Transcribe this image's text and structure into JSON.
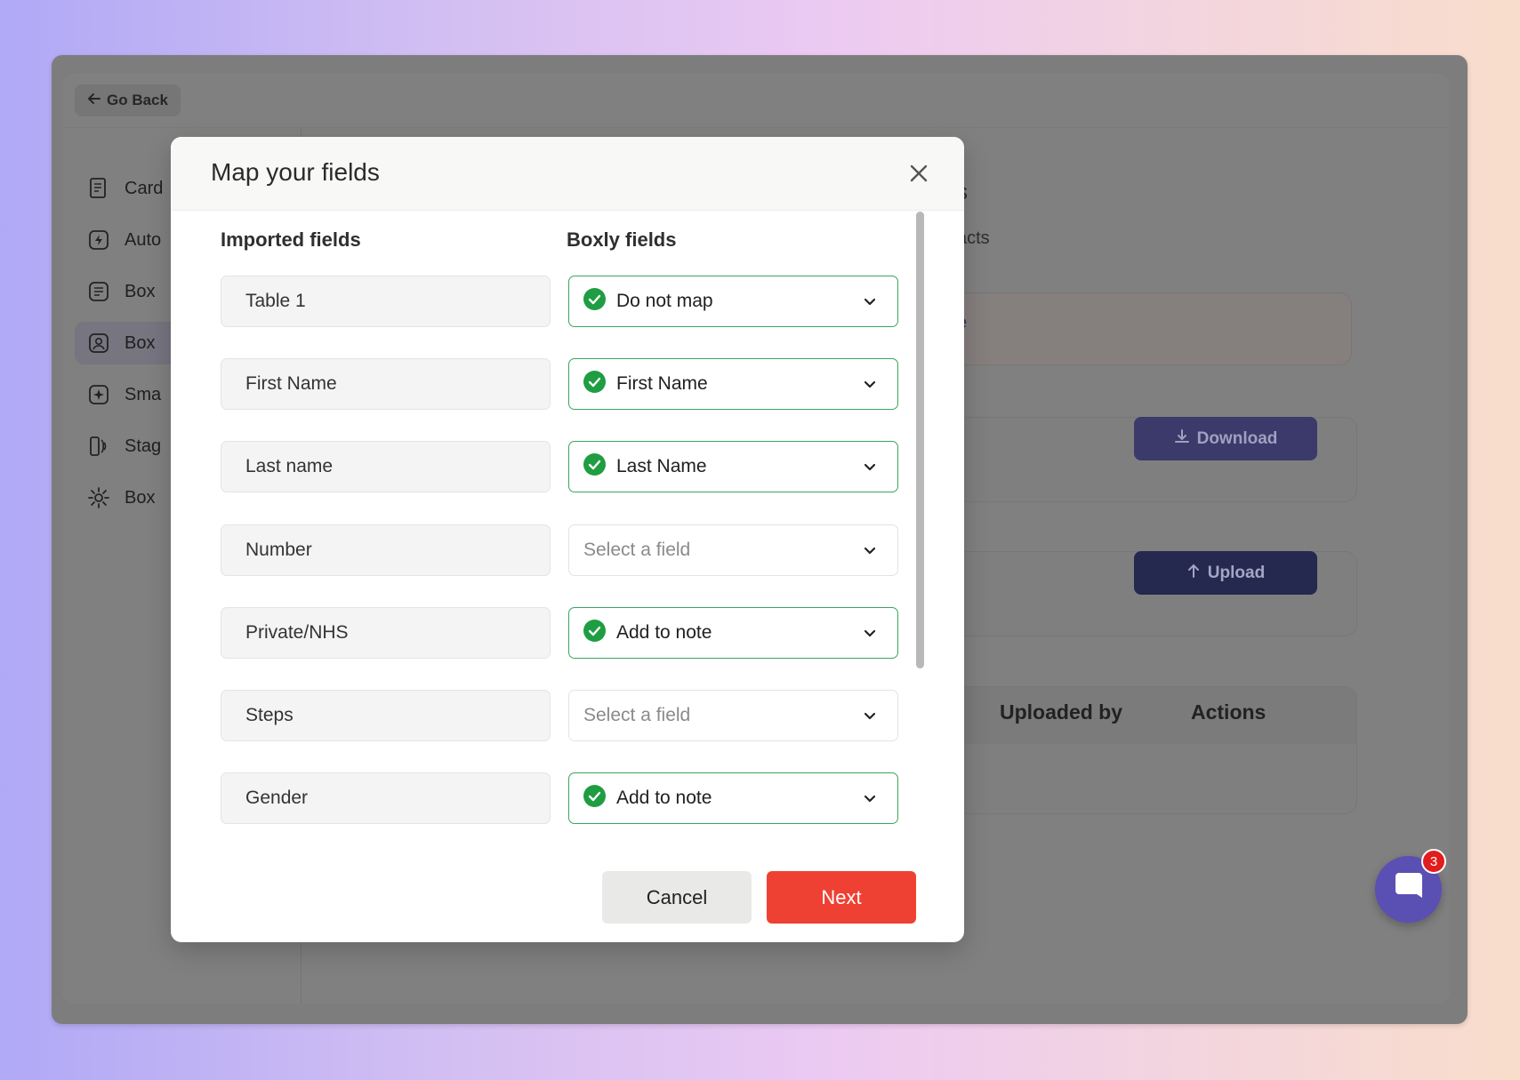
{
  "nav": {
    "back_label": "Go Back"
  },
  "sidebar": {
    "items": [
      {
        "label": "Card"
      },
      {
        "label": "Auto"
      },
      {
        "label": "Box"
      },
      {
        "label": "Box"
      },
      {
        "label": "Sma"
      },
      {
        "label": "Stag"
      },
      {
        "label": "Box"
      }
    ]
  },
  "background": {
    "heading_fragment": "s",
    "subtitle_fragment": "acts",
    "banner_fragment": "e",
    "download_label": "Download",
    "upload_label": "Upload",
    "table_headers": [
      "Uploaded by",
      "Actions"
    ]
  },
  "modal": {
    "title": "Map your fields",
    "col_imported": "Imported fields",
    "col_boxly": "Boxly fields",
    "rows": [
      {
        "imported": "Table 1",
        "mapped": "Do not map"
      },
      {
        "imported": "First Name",
        "mapped": "First Name"
      },
      {
        "imported": "Last name",
        "mapped": "Last Name"
      },
      {
        "imported": "Number",
        "mapped": "Select a field"
      },
      {
        "imported": "Private/NHS",
        "mapped": "Add to note"
      },
      {
        "imported": "Steps",
        "mapped": "Select a field"
      },
      {
        "imported": "Gender",
        "mapped": "Add to note"
      }
    ],
    "cancel_label": "Cancel",
    "next_label": "Next"
  },
  "chat": {
    "badge_count": "3"
  },
  "colors": {
    "accent_red": "#ef4133",
    "success_green": "#3aa55b",
    "chat_purple": "#5a4fb2"
  }
}
